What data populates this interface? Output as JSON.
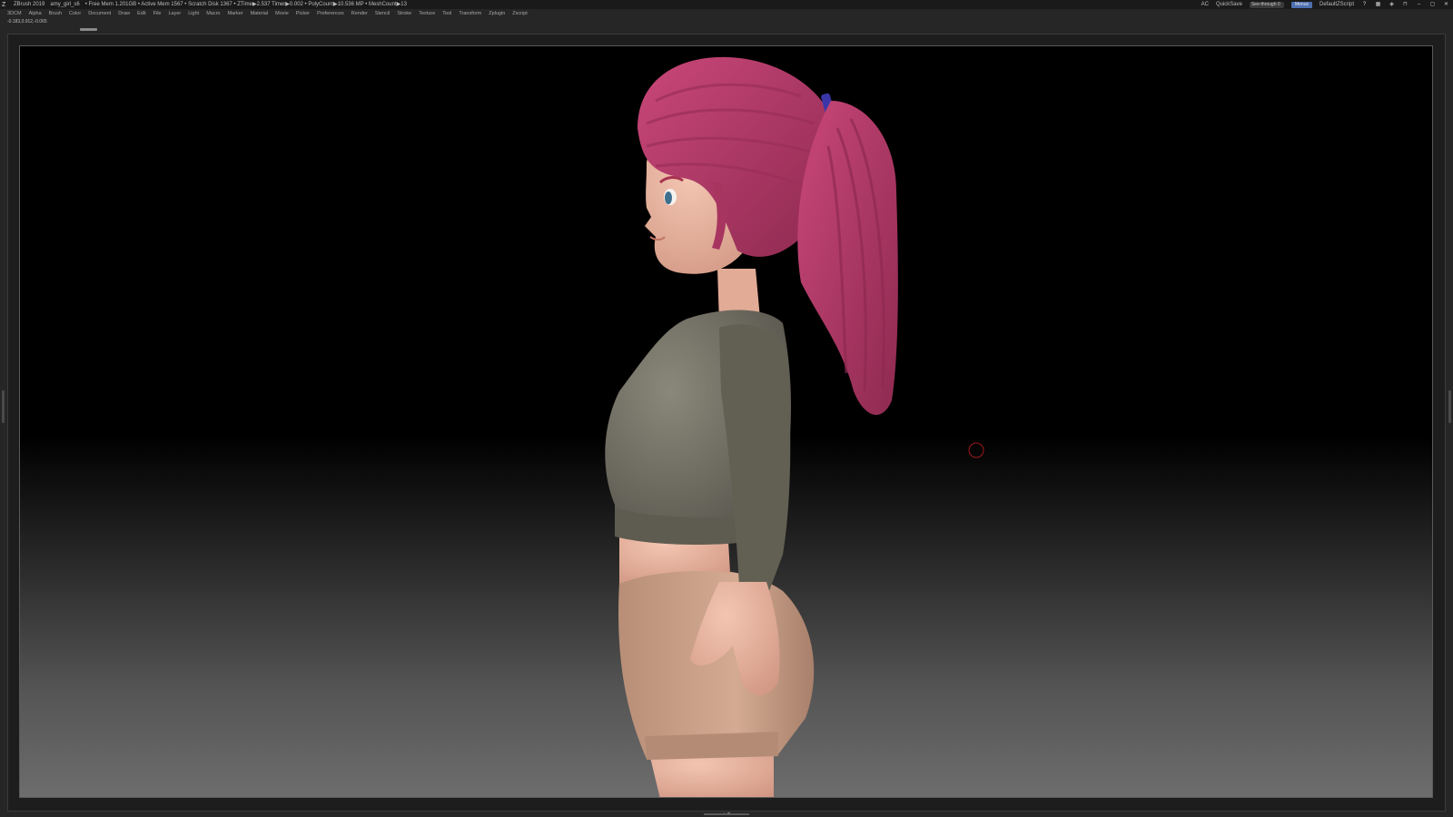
{
  "titlebar": {
    "app_name": "ZBrush 2019",
    "project": "amy_girl_s6",
    "stats": "• Free Mem 1.201GB • Active Mem 1567 • Scratch Disk 1367 • ZTime▶2.537 Timer▶0.002 • PolyCount▶10.536 MP • MeshCount▶13",
    "ac": "AC",
    "quicksave": "QuickSave",
    "see_through_label": "See-through",
    "see_through_value": "0",
    "see_through_fraction": 0,
    "menu_button": "Menus",
    "script": "DefaultZScript",
    "icons": [
      "help-icon",
      "layout-icon",
      "palette-icon",
      "lock-icon",
      "minimize-icon",
      "restore-icon",
      "close-icon"
    ]
  },
  "menubar": {
    "items": [
      "3DCM",
      "Alpha",
      "Brush",
      "Color",
      "Document",
      "Draw",
      "Edit",
      "File",
      "Layer",
      "Light",
      "Macro",
      "Marker",
      "Material",
      "Movie",
      "Picker",
      "Preferences",
      "Render",
      "Stencil",
      "Stroke",
      "Texture",
      "Tool",
      "Transform",
      "Zplugin",
      "Zscript"
    ]
  },
  "status": {
    "coords": "-0.183,0.912,-0.065"
  },
  "colors": {
    "hair": "#b83a68",
    "hair_dark": "#8e2a50",
    "skin": "#e9b6a2",
    "shirt": "#6d6a5d",
    "shorts": "#c79e86",
    "hair_tie": "#3a36a8",
    "cursor": "#a01818",
    "menu_accent": "#4d6fb0"
  }
}
